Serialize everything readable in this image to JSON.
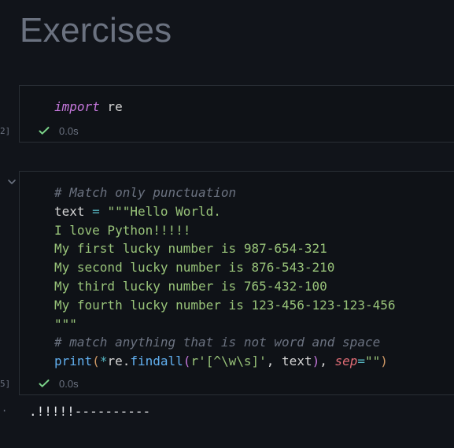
{
  "heading": "Exercises",
  "cells": [
    {
      "execution_label": "2]",
      "status_time": "0.0s",
      "code_lines": [
        [
          {
            "text": "import",
            "cls": "kw"
          },
          {
            "text": " re",
            "cls": "id"
          }
        ]
      ]
    },
    {
      "execution_label": "5]",
      "status_time": "0.0s",
      "code_lines": [
        [
          {
            "text": "# Match only punctuation",
            "cls": "cmt"
          }
        ],
        [
          {
            "text": "text",
            "cls": "id"
          },
          {
            "text": " = ",
            "cls": "op"
          },
          {
            "text": "\"\"\"Hello World.",
            "cls": "str"
          }
        ],
        [
          {
            "text": "I love Python!!!!!",
            "cls": "str"
          }
        ],
        [
          {
            "text": "My first lucky number is 987-654-321",
            "cls": "str"
          }
        ],
        [
          {
            "text": "My second lucky number is 876-543-210",
            "cls": "str"
          }
        ],
        [
          {
            "text": "My third lucky number is 765-432-100",
            "cls": "str"
          }
        ],
        [
          {
            "text": "My fourth lucky number is 123-456-123-123-456",
            "cls": "str"
          }
        ],
        [
          {
            "text": "\"\"\"",
            "cls": "str"
          }
        ],
        [
          {
            "text": "# match anything that is not word and space",
            "cls": "cmt"
          }
        ],
        [
          {
            "text": "print",
            "cls": "fn"
          },
          {
            "text": "(",
            "cls": "paren"
          },
          {
            "text": "*",
            "cls": "op"
          },
          {
            "text": "re",
            "cls": "id"
          },
          {
            "text": ".",
            "cls": "plain"
          },
          {
            "text": "findall",
            "cls": "fn"
          },
          {
            "text": "(",
            "cls": "paren2"
          },
          {
            "text": "r'",
            "cls": "str"
          },
          {
            "text": "[^\\w\\s]",
            "cls": "str"
          },
          {
            "text": "'",
            "cls": "str"
          },
          {
            "text": ", ",
            "cls": "plain"
          },
          {
            "text": "text",
            "cls": "id"
          },
          {
            "text": ")",
            "cls": "paren2"
          },
          {
            "text": ", ",
            "cls": "plain"
          },
          {
            "text": "sep",
            "cls": "param"
          },
          {
            "text": "=",
            "cls": "op"
          },
          {
            "text": "\"\"",
            "cls": "str"
          },
          {
            "text": ")",
            "cls": "paren"
          }
        ]
      ]
    }
  ],
  "output_marker": "·",
  "output_text": ".!!!!!----------",
  "colors": {
    "background": "#11141a",
    "cell_bg": "#0f1217",
    "cell_border": "#2a2f36",
    "check": "#7bd389"
  },
  "icons": {
    "success": "check-icon",
    "collapse": "chevron-down-icon"
  }
}
